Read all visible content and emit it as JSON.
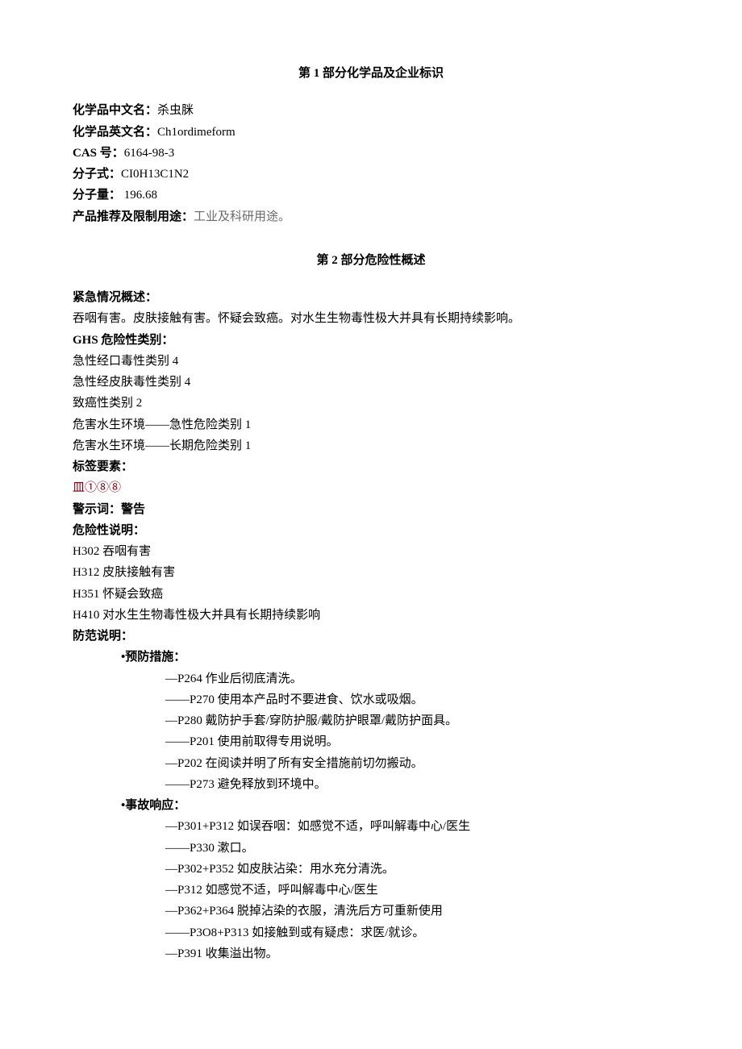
{
  "section1": {
    "heading": "第 1 部分化学品及企业标识",
    "fields": [
      {
        "label": "化学品中文名：",
        "value": "杀虫脒"
      },
      {
        "label": "化学品英文名：",
        "value": "Ch1ordimeform"
      },
      {
        "label": "CAS 号：",
        "value": "6164-98-3"
      },
      {
        "label": "分子式：",
        "value": "CI0H13C1N2"
      },
      {
        "label": "分子量：",
        "value": " 196.68"
      }
    ],
    "product_label": "产品推荐及限制用途：",
    "product_value": "工业及科研用途。"
  },
  "section2": {
    "heading": "第 2 部分危险性概述",
    "emergency_label": "紧急情况概述：",
    "emergency_text": "吞咽有害。皮肤接触有害。怀疑会致癌。对水生生物毒性极大并具有长期持续影响。",
    "ghs_label": "GHS 危险性类别：",
    "ghs_items": [
      "急性经口毒性类别 4",
      "急性经皮肤毒性类别 4",
      "致癌性类别 2",
      "危害水生环境——急性危险类别 1",
      "危害水生环境——长期危险类别 1"
    ],
    "tag_label": "标签要素：",
    "tag_value": "皿①⑧⑧",
    "signal_label": "警示词：警告",
    "hazard_label": "危险性说明：",
    "hazard_items": [
      "H302 吞咽有害",
      "H312 皮肤接触有害",
      "H351 怀疑会致癌",
      "H410 对水生生物毒性极大并具有长期持续影响"
    ],
    "prevention_heading": "防范说明：",
    "prevention_label": "•预防措施：",
    "prevention_items": [
      "—P264 作业后彻底清洗。",
      "——P270 使用本产品时不要进食、饮水或吸烟。",
      "—P280 戴防护手套/穿防护服/戴防护眼罩/戴防护面具。",
      "——P201 使用前取得专用说明。",
      "—P202 在阅读并明了所有安全措施前切勿搬动。",
      "——P273 避免释放到环境中。"
    ],
    "response_label": "•事故响应：",
    "response_items": [
      "—P301+P312 如误吞咽：如感觉不适，呼叫解毒中心/医生",
      "——P330 漱口。",
      "—P302+P352 如皮肤沾染：用水充分清洗。",
      "—P312 如感觉不适，呼叫解毒中心/医生",
      "—P362+P364 脱掉沾染的衣服，清洗后方可重新使用",
      "——P3O8+P313 如接触到或有疑虑：求医/就诊。",
      "—P391 收集溢出物。"
    ]
  }
}
